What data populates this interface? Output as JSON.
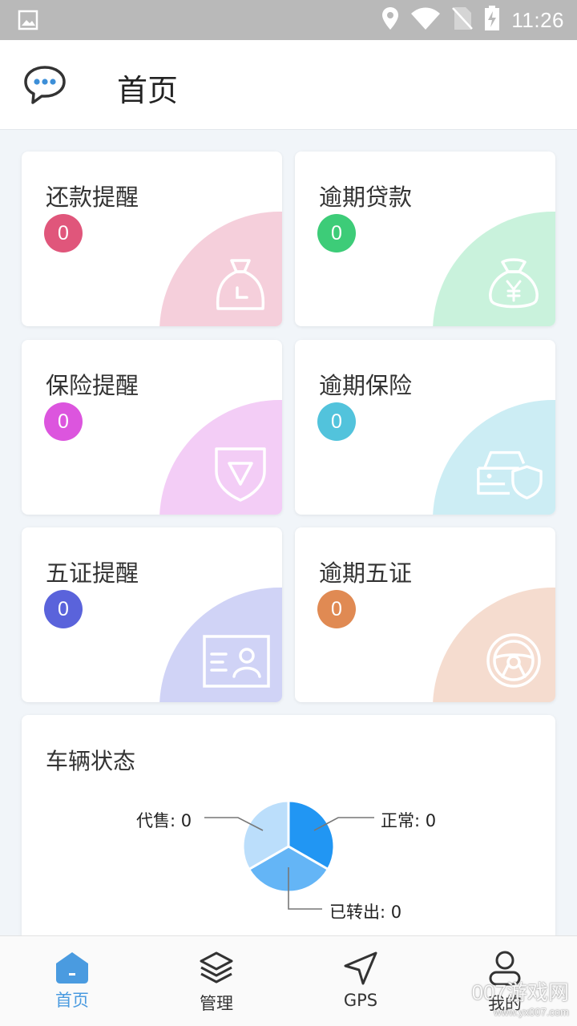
{
  "status_bar": {
    "time": "11:26"
  },
  "app_bar": {
    "title": "首页"
  },
  "cards": [
    {
      "label": "还款提醒",
      "count": "0"
    },
    {
      "label": "逾期贷款",
      "count": "0"
    },
    {
      "label": "保险提醒",
      "count": "0"
    },
    {
      "label": "逾期保险",
      "count": "0"
    },
    {
      "label": "五证提醒",
      "count": "0"
    },
    {
      "label": "逾期五证",
      "count": "0"
    }
  ],
  "vehicle_status": {
    "title": "车辆状态",
    "chart_data": {
      "type": "pie",
      "categories": [
        "正常",
        "已转出",
        "代售"
      ],
      "values": [
        0,
        0,
        0
      ],
      "labels": [
        "正常: 0",
        "已转出: 0",
        "代售: 0"
      ],
      "colors": [
        "#2196f3",
        "#64b5f6",
        "#bbdefb"
      ],
      "legend": "none"
    }
  },
  "tabs": [
    {
      "label": "首页",
      "active": true
    },
    {
      "label": "管理",
      "active": false
    },
    {
      "label": "GPS",
      "active": false
    },
    {
      "label": "我的",
      "active": false
    }
  ],
  "watermark": {
    "main": "007游戏网",
    "sub": "www.yx007.com"
  }
}
